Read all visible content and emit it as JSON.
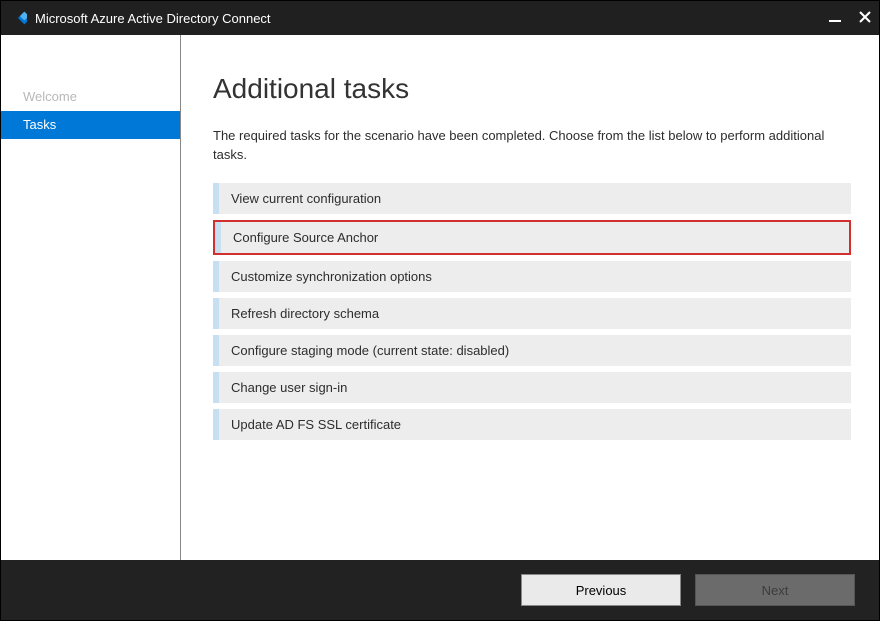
{
  "titlebar": {
    "title": "Microsoft Azure Active Directory Connect"
  },
  "sidebar": {
    "items": [
      {
        "label": "Welcome",
        "active": false
      },
      {
        "label": "Tasks",
        "active": true
      }
    ]
  },
  "content": {
    "heading": "Additional tasks",
    "description": "The required tasks for the scenario have been completed. Choose from the list below to perform additional tasks.",
    "tasks": [
      {
        "label": "View current configuration",
        "highlighted": false
      },
      {
        "label": "Configure Source Anchor",
        "highlighted": true
      },
      {
        "label": "Customize synchronization options",
        "highlighted": false
      },
      {
        "label": "Refresh directory schema",
        "highlighted": false
      },
      {
        "label": "Configure staging mode (current state: disabled)",
        "highlighted": false
      },
      {
        "label": "Change user sign-in",
        "highlighted": false
      },
      {
        "label": "Update AD FS SSL certificate",
        "highlighted": false
      }
    ]
  },
  "footer": {
    "previous_label": "Previous",
    "next_label": "Next"
  }
}
